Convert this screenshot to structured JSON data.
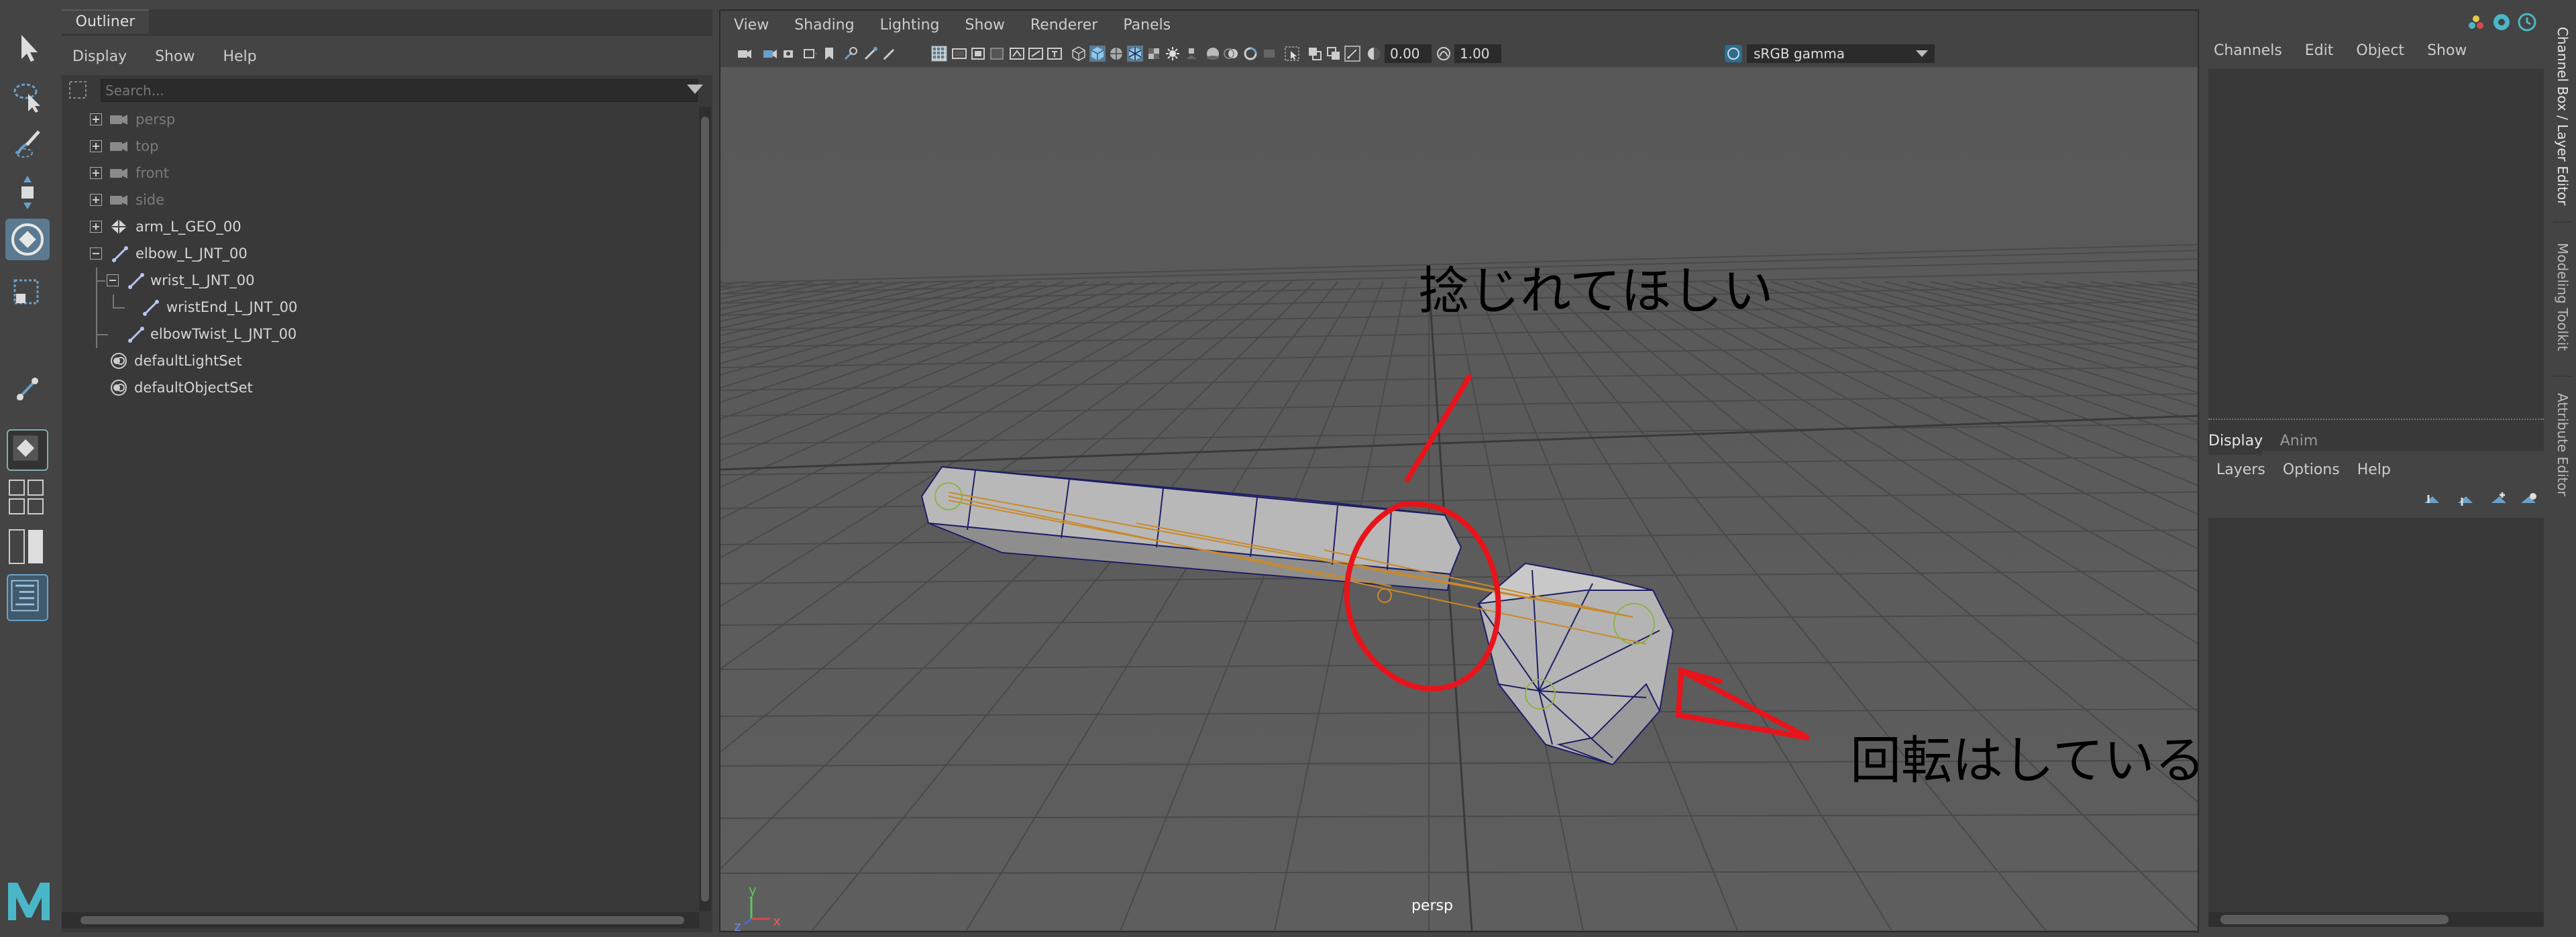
{
  "left_toolbar": {
    "tools": [
      {
        "name": "select-tool-icon",
        "active": false
      },
      {
        "name": "lasso-tool-icon",
        "active": false
      },
      {
        "name": "paint-select-tool-icon",
        "active": false
      },
      {
        "name": "move-tool-icon",
        "active": false
      },
      {
        "name": "rotate-tool-icon",
        "active": true
      },
      {
        "name": "scale-tool-icon",
        "active": false
      },
      {
        "name": "last-tool-icon",
        "active": false
      }
    ],
    "layout_buttons": [
      "single-pane-layout-icon",
      "four-pane-layout-icon",
      "two-pane-layout-icon",
      "outliner-layout-icon"
    ],
    "logo": "maya-logo"
  },
  "outliner": {
    "tab_label": "Outliner",
    "menu": [
      "Display",
      "Show",
      "Help"
    ],
    "search_placeholder": "Search...",
    "items": [
      {
        "label": "persp",
        "icon": "camera",
        "dim": true
      },
      {
        "label": "top",
        "icon": "camera",
        "dim": true
      },
      {
        "label": "front",
        "icon": "camera",
        "dim": true
      },
      {
        "label": "side",
        "icon": "camera",
        "dim": true
      },
      {
        "label": "arm_L_GEO_00",
        "icon": "mesh",
        "dim": false
      },
      {
        "label": "elbow_L_JNT_00",
        "icon": "joint",
        "dim": false
      },
      {
        "label": "wrist_L_JNT_00",
        "icon": "joint",
        "dim": false
      },
      {
        "label": "wristEnd_L_JNT_00",
        "icon": "joint",
        "dim": false
      },
      {
        "label": "elbowTwist_L_JNT_00",
        "icon": "joint",
        "dim": false
      },
      {
        "label": "defaultLightSet",
        "icon": "set",
        "dim": false
      },
      {
        "label": "defaultObjectSet",
        "icon": "set",
        "dim": false
      }
    ]
  },
  "viewport": {
    "menu": [
      "View",
      "Shading",
      "Lighting",
      "Show",
      "Renderer",
      "Panels"
    ],
    "exposure_value": "0.00",
    "gamma_value": "1.00",
    "color_space": "sRGB gamma",
    "camera_label": "persp",
    "axis_labels": {
      "y": "y",
      "z": "z",
      "x": "x"
    },
    "annotations": {
      "top_text": "捻じれてほしい",
      "right_text": "回転はしている"
    },
    "colors": {
      "annotation": "#e8141b",
      "wireframe": "#1e1e66",
      "joint": "#c98a2a"
    }
  },
  "right_panel": {
    "channel_menu": [
      "Channels",
      "Edit",
      "Object",
      "Show"
    ],
    "layer_tabs": [
      "Display",
      "Anim"
    ],
    "layer_menu": [
      "Layers",
      "Options",
      "Help"
    ]
  },
  "side_tabs": [
    "Channel Box / Layer Editor",
    "Modeling Toolkit",
    "Attribute Editor"
  ]
}
